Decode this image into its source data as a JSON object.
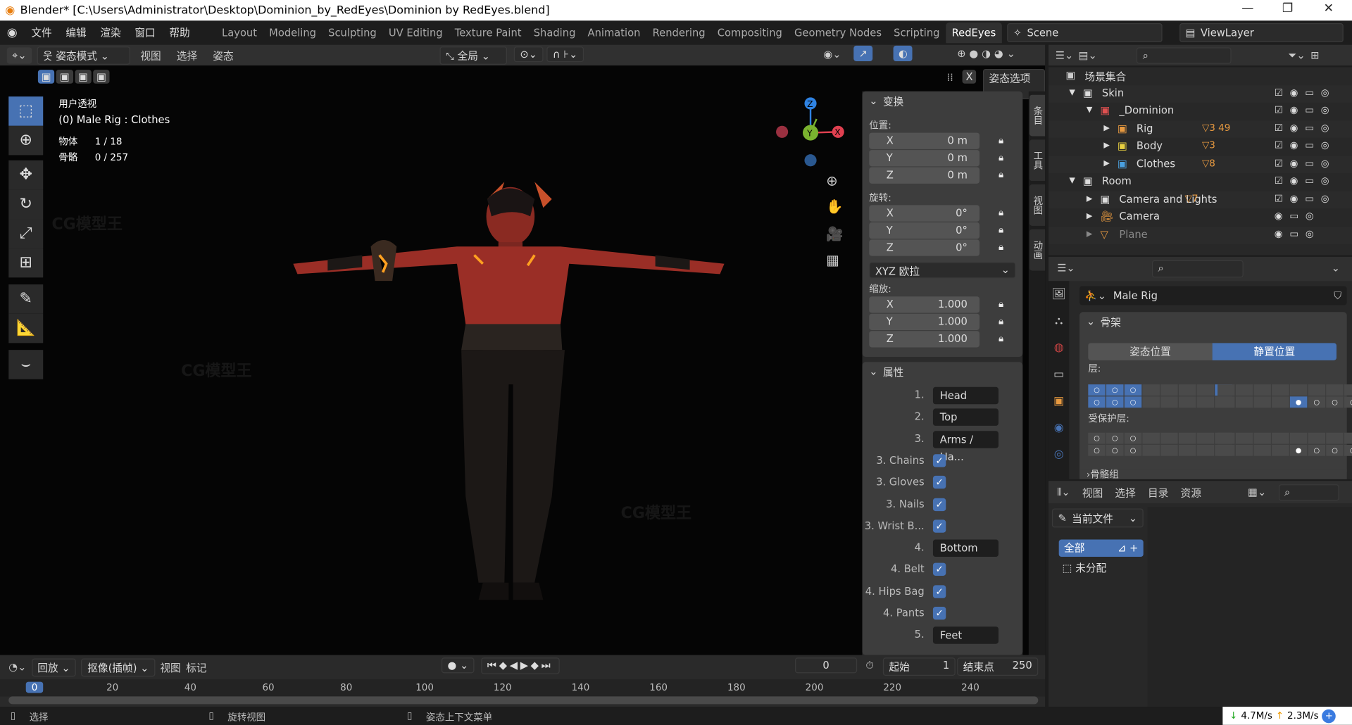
{
  "window": {
    "title": "Blender* [C:\\Users\\Administrator\\Desktop\\Dominion_by_RedEyes\\Dominion by RedEyes.blend]",
    "minimize": "—",
    "restore": "❐",
    "close": "✕"
  },
  "menu": [
    "文件",
    "编辑",
    "渲染",
    "窗口",
    "帮助"
  ],
  "workspaces": [
    "Layout",
    "Modeling",
    "Sculpting",
    "UV Editing",
    "Texture Paint",
    "Shading",
    "Animation",
    "Rendering",
    "Compositing",
    "Geometry Nodes",
    "Scripting",
    "RedEyes"
  ],
  "workspace_add": "+",
  "active_workspace": "RedEyes",
  "scene": {
    "label": "Scene",
    "viewlayer": "ViewLayer"
  },
  "viewport_header": {
    "mode": "姿态模式",
    "menus": [
      "视图",
      "选择",
      "姿态"
    ],
    "orientation": "全局",
    "pose_options": "姿态选项",
    "x_mirror": "X"
  },
  "viewport_overlay": {
    "view": "用户透视",
    "context": "(0) Male Rig : Clothes",
    "objects_label": "物体",
    "objects": "1 / 18",
    "bones_label": "骨骼",
    "bones": "0 / 257"
  },
  "gizmo": {
    "x": "X",
    "y": "Y",
    "z": "Z"
  },
  "npanel": {
    "tabs": [
      "条目",
      "工具",
      "视图",
      "动画"
    ],
    "transform": {
      "title": "变换",
      "location_label": "位置:",
      "location": [
        {
          "axis": "X",
          "value": "0 m"
        },
        {
          "axis": "Y",
          "value": "0 m"
        },
        {
          "axis": "Z",
          "value": "0 m"
        }
      ],
      "rotation_label": "旋转:",
      "rotation": [
        {
          "axis": "X",
          "value": "0°"
        },
        {
          "axis": "Y",
          "value": "0°"
        },
        {
          "axis": "Z",
          "value": "0°"
        }
      ],
      "rotation_mode": "XYZ 欧拉",
      "scale_label": "缩放:",
      "scale": [
        {
          "axis": "X",
          "value": "1.000"
        },
        {
          "axis": "Y",
          "value": "1.000"
        },
        {
          "axis": "Z",
          "value": "1.000"
        }
      ]
    },
    "properties": {
      "title": "属性",
      "rows": [
        {
          "label": "1.",
          "type": "text",
          "value": "Head"
        },
        {
          "label": "2.",
          "type": "text",
          "value": "Top"
        },
        {
          "label": "3.",
          "type": "text",
          "value": "Arms / Ha..."
        },
        {
          "label": "3. Chains",
          "type": "check",
          "checked": true
        },
        {
          "label": "3. Gloves",
          "type": "check",
          "checked": true
        },
        {
          "label": "3. Nails",
          "type": "check",
          "checked": true
        },
        {
          "label": "3. Wrist B...",
          "type": "check",
          "checked": true
        },
        {
          "label": "4.",
          "type": "text",
          "value": "Bottom"
        },
        {
          "label": "4. Belt",
          "type": "check",
          "checked": true
        },
        {
          "label": "4. Hips Bag",
          "type": "check",
          "checked": true
        },
        {
          "label": "4. Pants",
          "type": "check",
          "checked": true
        },
        {
          "label": "5.",
          "type": "text",
          "value": "Feet"
        }
      ]
    }
  },
  "outliner": {
    "rows": [
      {
        "name": "场景集合",
        "indent": 0,
        "icon": "collection-icon",
        "color": "#cccccc"
      },
      {
        "name": "Skin",
        "indent": 1,
        "icon": "collection-icon",
        "color": "#dddddd",
        "extra": ""
      },
      {
        "name": "_Dominion",
        "indent": 2,
        "icon": "collection-icon",
        "color": "#e05050"
      },
      {
        "name": "Rig",
        "indent": 3,
        "icon": "collection-icon",
        "color": "#e89a40",
        "extra": "3 49"
      },
      {
        "name": "Body",
        "indent": 3,
        "icon": "collection-icon",
        "color": "#e8d040",
        "extra": "3"
      },
      {
        "name": "Clothes",
        "indent": 3,
        "icon": "collection-icon",
        "color": "#4aa0e0",
        "extra": "8"
      },
      {
        "name": "Room",
        "indent": 1,
        "icon": "collection-icon",
        "color": "#dddddd"
      },
      {
        "name": "Camera and Lights",
        "indent": 2,
        "icon": "collection-icon",
        "color": "#dddddd",
        "extra": "7"
      },
      {
        "name": "Camera",
        "indent": 2,
        "icon": "camera-icon",
        "color": "#e89a40"
      },
      {
        "name": "Plane",
        "indent": 2,
        "icon": "mesh-icon",
        "color": "#e89a40",
        "dim": true
      }
    ]
  },
  "properties_editor": {
    "object_name": "Male Rig",
    "section": "骨架",
    "pose_position": "姿态位置",
    "rest_position": "静置位置",
    "active_position": "静置位置",
    "layers_label": "层:",
    "protected_label": "受保护层:",
    "bone_groups": "骨骼组"
  },
  "file_browser": {
    "menus": [
      "视图",
      "选择",
      "目录",
      "资源"
    ],
    "source": "当前文件",
    "all": "全部",
    "unassigned": "未分配"
  },
  "timeline": {
    "menus": [
      "回放",
      "抠像(插帧)",
      "视图",
      "标记"
    ],
    "current_frame": "0",
    "start_label": "起始",
    "start": "1",
    "end_label": "结束点",
    "end": "250",
    "ticks": [
      "0",
      "20",
      "40",
      "60",
      "80",
      "100",
      "120",
      "140",
      "160",
      "180",
      "200",
      "220",
      "240"
    ]
  },
  "statusbar": {
    "items": [
      "选择",
      "旋转视图",
      "姿态上下文菜单"
    ],
    "down": "4.7M/s",
    "up": "2.3M/s"
  },
  "colors": {
    "accent": "#4772b3",
    "active_tab": "#303030"
  }
}
